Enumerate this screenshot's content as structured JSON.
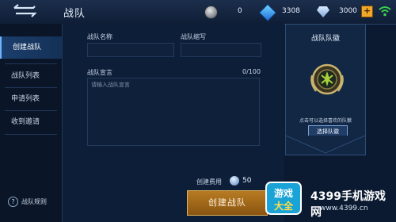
{
  "header": {
    "title": "战队",
    "resources": [
      {
        "name": "gold-coin",
        "value": "0"
      },
      {
        "name": "blue-gem",
        "value": "3308"
      },
      {
        "name": "diamond",
        "value": "3000"
      }
    ],
    "plus": "+"
  },
  "sidebar": {
    "items": [
      {
        "label": "创建战队",
        "active": true
      },
      {
        "label": "战队列表",
        "active": false
      },
      {
        "label": "申请列表",
        "active": false
      },
      {
        "label": "收到邀请",
        "active": false
      }
    ],
    "rules_label": "战队规则",
    "rules_icon": "?"
  },
  "form": {
    "name_label": "战队名称",
    "abbr_label": "战队缩写",
    "manifesto_label": "战队宣言",
    "manifesto_count": "0/100",
    "manifesto_placeholder": "请输入战队宣言"
  },
  "emblem": {
    "title": "战队队徽",
    "hint": "点击可以选择喜欢的队徽",
    "button": "选择队徽"
  },
  "footer": {
    "fee_label": "创建费用",
    "fee_value": "50",
    "create_button": "创建战队"
  },
  "watermark": {
    "brand": "4399手机游戏网",
    "url": "www.4399.cn",
    "logo_text": "游戏大全"
  },
  "colors": {
    "accent": "#6db4ff",
    "button_gold": "#b77b22",
    "panel": "#112744"
  }
}
